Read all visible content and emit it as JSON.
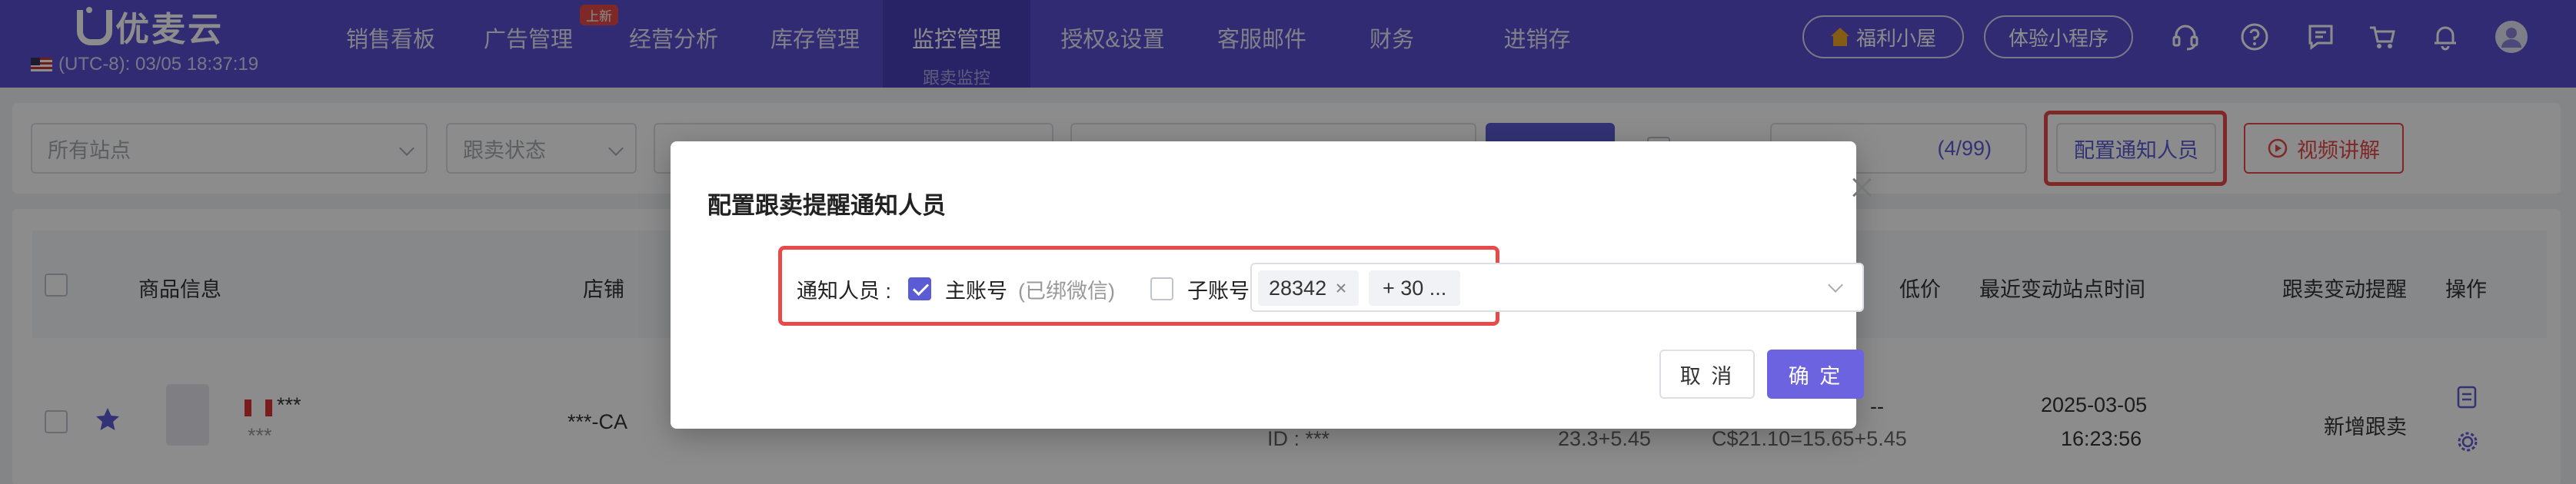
{
  "brand": {
    "name": "优麦云"
  },
  "timezone": "(UTC-8): 03/05 18:37:19",
  "nav": {
    "items": [
      "销售看板",
      "广告管理",
      "经营分析",
      "库存管理",
      "监控管理",
      "授权&设置",
      "客服邮件",
      "财务",
      "进销存"
    ],
    "active_sub": "跟卖监控",
    "new_tag": "上新"
  },
  "header_buttons": {
    "welfare": "福利小屋",
    "miniapp": "体验小程序"
  },
  "icons": [
    "headset-icon",
    "help-icon",
    "message-icon",
    "cart-icon",
    "bell-icon",
    "avatar-icon"
  ],
  "filters": {
    "site_placeholder": "所有站点",
    "status_placeholder": "跟卖状态",
    "quota": "(4/99)",
    "config_button": "配置通知人员",
    "video_button": "视频讲解"
  },
  "table": {
    "headers": [
      "商品信息",
      "店铺",
      "低价",
      "最近变动站点时间",
      "跟卖变动提醒",
      "操作"
    ],
    "row": {
      "product_title": "***",
      "product_sub": "***",
      "store": "***-CA",
      "id_label": "ID : ***",
      "price_a": "23.3+5.45",
      "price_b": "--",
      "price_c": "C$21.10=15.65+5.45",
      "date": "2025-03-05",
      "time": "16:23:56",
      "alert": "新增跟卖"
    }
  },
  "modal": {
    "title": "配置跟卖提醒通知人员",
    "label": "通知人员 :",
    "main_account": "主账号",
    "main_note": "(已绑微信)",
    "main_checked": true,
    "sub_account": "子账号",
    "sub_checked": false,
    "tags": [
      "28342",
      "+ 30 ..."
    ],
    "cancel": "取 消",
    "confirm": "确 定"
  },
  "colors": {
    "nav_bg": "#5a4fd1",
    "primary": "#5b5bd6",
    "highlight": "#e84a4a"
  }
}
